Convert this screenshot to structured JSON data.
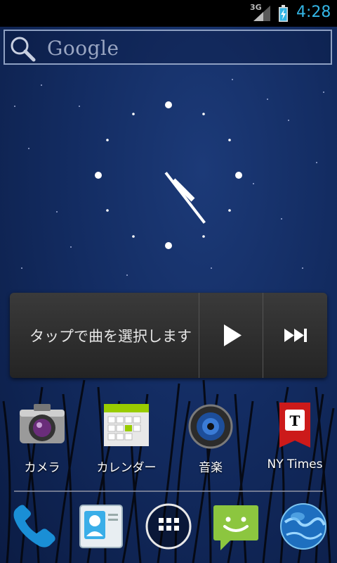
{
  "status_bar": {
    "network_label": "3G",
    "time": "4:28"
  },
  "search": {
    "label": "Google"
  },
  "music_widget": {
    "prompt": "タップで曲を選択します"
  },
  "apps": [
    {
      "label": "カメラ",
      "icon": "camera-icon"
    },
    {
      "label": "カレンダー",
      "icon": "calendar-icon"
    },
    {
      "label": "音楽",
      "icon": "music-icon"
    },
    {
      "label": "NY Times",
      "icon": "nytimes-icon"
    }
  ],
  "dock": [
    {
      "icon": "phone-icon"
    },
    {
      "icon": "contacts-icon"
    },
    {
      "icon": "app-drawer-icon"
    },
    {
      "icon": "messaging-icon"
    },
    {
      "icon": "browser-icon"
    }
  ],
  "colors": {
    "accent": "#33b5e5",
    "wallpaper": "#132c62"
  }
}
